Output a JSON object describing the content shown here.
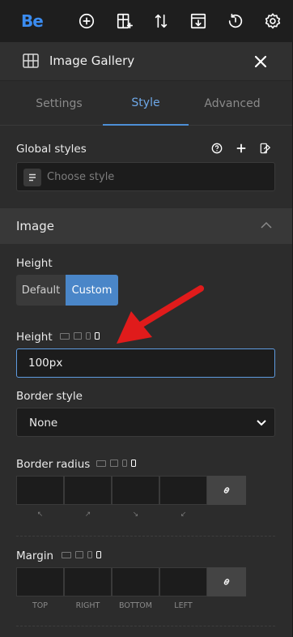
{
  "topbar": {
    "logo": "Be",
    "icons": [
      "add-icon",
      "add-section-icon",
      "sort-icon",
      "import-icon",
      "history-icon",
      "settings-icon"
    ]
  },
  "panel": {
    "title": "Image Gallery",
    "tabs": [
      "Settings",
      "Style",
      "Advanced"
    ],
    "active_tab": "Style"
  },
  "global_styles": {
    "label": "Global styles",
    "placeholder": "Choose style"
  },
  "image_section": {
    "title": "Image",
    "height_mode_label": "Height",
    "modes": [
      "Default",
      "Custom"
    ],
    "selected_mode": "Custom",
    "height_label": "Height",
    "height_value": "100px",
    "border_style_label": "Border style",
    "border_style_value": "None",
    "border_radius_label": "Border radius",
    "margin_label": "Margin",
    "corner_glyphs": [
      "↖",
      "↗",
      "↘",
      "↙"
    ],
    "sides": [
      "TOP",
      "RIGHT",
      "BOTTOM",
      "LEFT"
    ]
  },
  "colors": {
    "accent": "#4a86c8",
    "logo": "#3b8cf0",
    "annotation_arrow": "#e01b1b"
  }
}
